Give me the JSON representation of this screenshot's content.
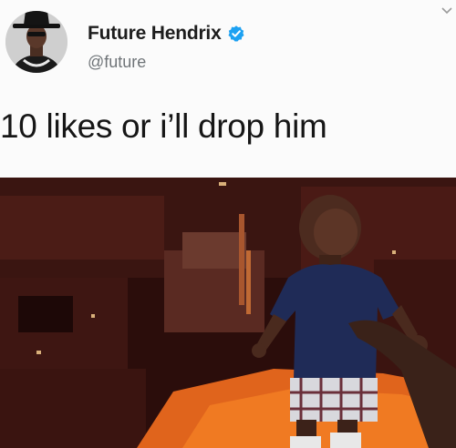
{
  "tweet": {
    "display_name": "Future Hendrix",
    "handle": "@future",
    "text": "10 likes or i’ll drop him",
    "verified": true,
    "avatar_icon": "profile-avatar",
    "menu_icon": "chevron-down-icon",
    "verified_icon": "verified-badge-icon"
  },
  "media": {
    "alt_icon": "photo-media",
    "scene": "minecraft-nether-with-baby"
  },
  "colors": {
    "verified_blue": "#1da1f2",
    "name_text": "#1d1d1d",
    "handle_text": "#6f7478",
    "background": "#fbfbfb"
  }
}
